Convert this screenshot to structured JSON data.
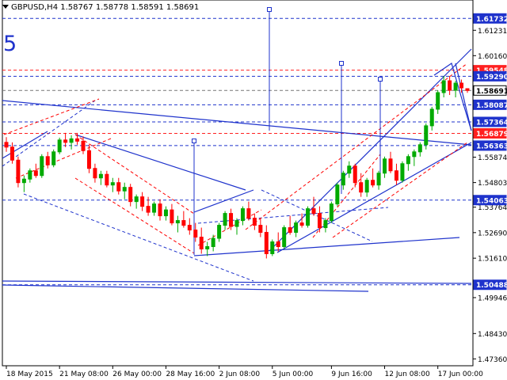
{
  "header": {
    "symbol": "GBPUSD,H4",
    "open": "1.58767",
    "high": "1.58778",
    "low": "1.58591",
    "close": "1.58691"
  },
  "wave_label": "5",
  "colors": {
    "background": "#ffffff",
    "bull_candle": "#00aa00",
    "bear_candle": "#ff0000",
    "trendline": "#1f33cc",
    "channel_red": "#ff0000",
    "price_tag_blue": "#1f33cc",
    "price_tag_red": "#ff2020",
    "current_price_tag": "#ffffff"
  },
  "chart_data": {
    "type": "candlestick",
    "title": "",
    "ylim": [
      1.4707,
      1.6251
    ],
    "y_ticks": [
      "1.61231",
      "1.60160",
      "1.56791",
      "1.55874",
      "1.54803",
      "1.53764",
      "1.52690",
      "1.51610",
      "1.49946",
      "1.48430",
      "1.47360"
    ],
    "x_ticks": [
      "18 May 2015",
      "21 May 08:00",
      "26 May 00:00",
      "28 May 16:00",
      "2 Jun 08:00",
      "5 Jun 00:00",
      "9 Jun 16:00",
      "12 Jun 08:00",
      "17 Jun 00:00"
    ],
    "level_tags": [
      {
        "price": 1.61732,
        "label": "1.61732",
        "style": "blue"
      },
      {
        "price": 1.59548,
        "label": "1.59548",
        "style": "red"
      },
      {
        "price": 1.5929,
        "label": "1.59290",
        "style": "blue"
      },
      {
        "price": 1.58691,
        "label": "1.58691",
        "style": "current"
      },
      {
        "price": 1.58087,
        "label": "1.58087",
        "style": "blue"
      },
      {
        "price": 1.57364,
        "label": "1.57364",
        "style": "blue"
      },
      {
        "price": 1.56879,
        "label": "1.56879",
        "style": "red"
      },
      {
        "price": 1.56363,
        "label": "1.56363",
        "style": "blue"
      },
      {
        "price": 1.54063,
        "label": "1.54063",
        "style": "blue"
      },
      {
        "price": 1.50488,
        "label": "1.50488",
        "style": "blue"
      }
    ],
    "candles": [
      [
        1.565,
        1.5672,
        1.561,
        1.563
      ],
      [
        1.563,
        1.565,
        1.556,
        1.5575
      ],
      [
        1.5575,
        1.559,
        1.546,
        1.548
      ],
      [
        1.548,
        1.551,
        1.544,
        1.5495
      ],
      [
        1.5495,
        1.554,
        1.548,
        1.553
      ],
      [
        1.553,
        1.556,
        1.55,
        1.551
      ],
      [
        1.551,
        1.56,
        1.55,
        1.559
      ],
      [
        1.559,
        1.561,
        1.554,
        1.5555
      ],
      [
        1.5555,
        1.562,
        1.5545,
        1.561
      ],
      [
        1.561,
        1.567,
        1.56,
        1.566
      ],
      [
        1.566,
        1.569,
        1.563,
        1.565
      ],
      [
        1.565,
        1.568,
        1.562,
        1.5665
      ],
      [
        1.5665,
        1.569,
        1.564,
        1.5655
      ],
      [
        1.5655,
        1.5675,
        1.56,
        1.5615
      ],
      [
        1.5615,
        1.564,
        1.552,
        1.554
      ],
      [
        1.554,
        1.556,
        1.548,
        1.55
      ],
      [
        1.55,
        1.553,
        1.547,
        1.5515
      ],
      [
        1.5515,
        1.553,
        1.546,
        1.547
      ],
      [
        1.547,
        1.55,
        1.544,
        1.548
      ],
      [
        1.548,
        1.55,
        1.543,
        1.5445
      ],
      [
        1.5445,
        1.548,
        1.541,
        1.546
      ],
      [
        1.546,
        1.5475,
        1.538,
        1.54
      ],
      [
        1.54,
        1.543,
        1.537,
        1.542
      ],
      [
        1.542,
        1.544,
        1.536,
        1.538
      ],
      [
        1.538,
        1.542,
        1.534,
        1.5355
      ],
      [
        1.5355,
        1.54,
        1.534,
        1.539
      ],
      [
        1.539,
        1.541,
        1.532,
        1.534
      ],
      [
        1.534,
        1.538,
        1.532,
        1.5365
      ],
      [
        1.5365,
        1.539,
        1.53,
        1.531
      ],
      [
        1.531,
        1.534,
        1.527,
        1.532
      ],
      [
        1.532,
        1.536,
        1.529,
        1.53
      ],
      [
        1.53,
        1.533,
        1.526,
        1.528
      ],
      [
        1.528,
        1.531,
        1.523,
        1.525
      ],
      [
        1.525,
        1.529,
        1.518,
        1.52
      ],
      [
        1.52,
        1.523,
        1.517,
        1.521
      ],
      [
        1.521,
        1.526,
        1.519,
        1.5245
      ],
      [
        1.5245,
        1.531,
        1.523,
        1.53
      ],
      [
        1.53,
        1.536,
        1.528,
        1.535
      ],
      [
        1.535,
        1.537,
        1.528,
        1.5295
      ],
      [
        1.5295,
        1.533,
        1.526,
        1.532
      ],
      [
        1.532,
        1.538,
        1.53,
        1.537
      ],
      [
        1.537,
        1.54,
        1.532,
        1.533
      ],
      [
        1.533,
        1.535,
        1.528,
        1.53
      ],
      [
        1.53,
        1.533,
        1.525,
        1.527
      ],
      [
        1.527,
        1.53,
        1.516,
        1.518
      ],
      [
        1.518,
        1.524,
        1.517,
        1.523
      ],
      [
        1.523,
        1.527,
        1.519,
        1.521
      ],
      [
        1.521,
        1.53,
        1.52,
        1.529
      ],
      [
        1.529,
        1.534,
        1.526,
        1.527
      ],
      [
        1.527,
        1.532,
        1.525,
        1.531
      ],
      [
        1.531,
        1.535,
        1.529,
        1.53
      ],
      [
        1.53,
        1.538,
        1.529,
        1.537
      ],
      [
        1.537,
        1.542,
        1.534,
        1.535
      ],
      [
        1.535,
        1.538,
        1.527,
        1.529
      ],
      [
        1.529,
        1.533,
        1.527,
        1.532
      ],
      [
        1.532,
        1.54,
        1.531,
        1.539
      ],
      [
        1.539,
        1.548,
        1.538,
        1.547
      ],
      [
        1.547,
        1.553,
        1.545,
        1.552
      ],
      [
        1.552,
        1.557,
        1.55,
        1.555
      ],
      [
        1.555,
        1.556,
        1.546,
        1.548
      ],
      [
        1.548,
        1.552,
        1.542,
        1.544
      ],
      [
        1.544,
        1.55,
        1.542,
        1.549
      ],
      [
        1.549,
        1.554,
        1.546,
        1.547
      ],
      [
        1.547,
        1.553,
        1.545,
        1.552
      ],
      [
        1.552,
        1.559,
        1.55,
        1.558
      ],
      [
        1.558,
        1.561,
        1.552,
        1.553
      ],
      [
        1.553,
        1.556,
        1.547,
        1.549
      ],
      [
        1.549,
        1.557,
        1.548,
        1.556
      ],
      [
        1.556,
        1.56,
        1.553,
        1.559
      ],
      [
        1.559,
        1.562,
        1.555,
        1.561
      ],
      [
        1.561,
        1.565,
        1.559,
        1.564
      ],
      [
        1.564,
        1.573,
        1.562,
        1.572
      ],
      [
        1.572,
        1.58,
        1.57,
        1.579
      ],
      [
        1.579,
        1.587,
        1.577,
        1.586
      ],
      [
        1.586,
        1.593,
        1.584,
        1.591
      ],
      [
        1.591,
        1.593,
        1.585,
        1.587
      ],
      [
        1.587,
        1.591,
        1.584,
        1.59
      ],
      [
        1.59,
        1.5915,
        1.586,
        1.588
      ],
      [
        1.58767,
        1.58778,
        1.58591,
        1.58691
      ]
    ]
  }
}
